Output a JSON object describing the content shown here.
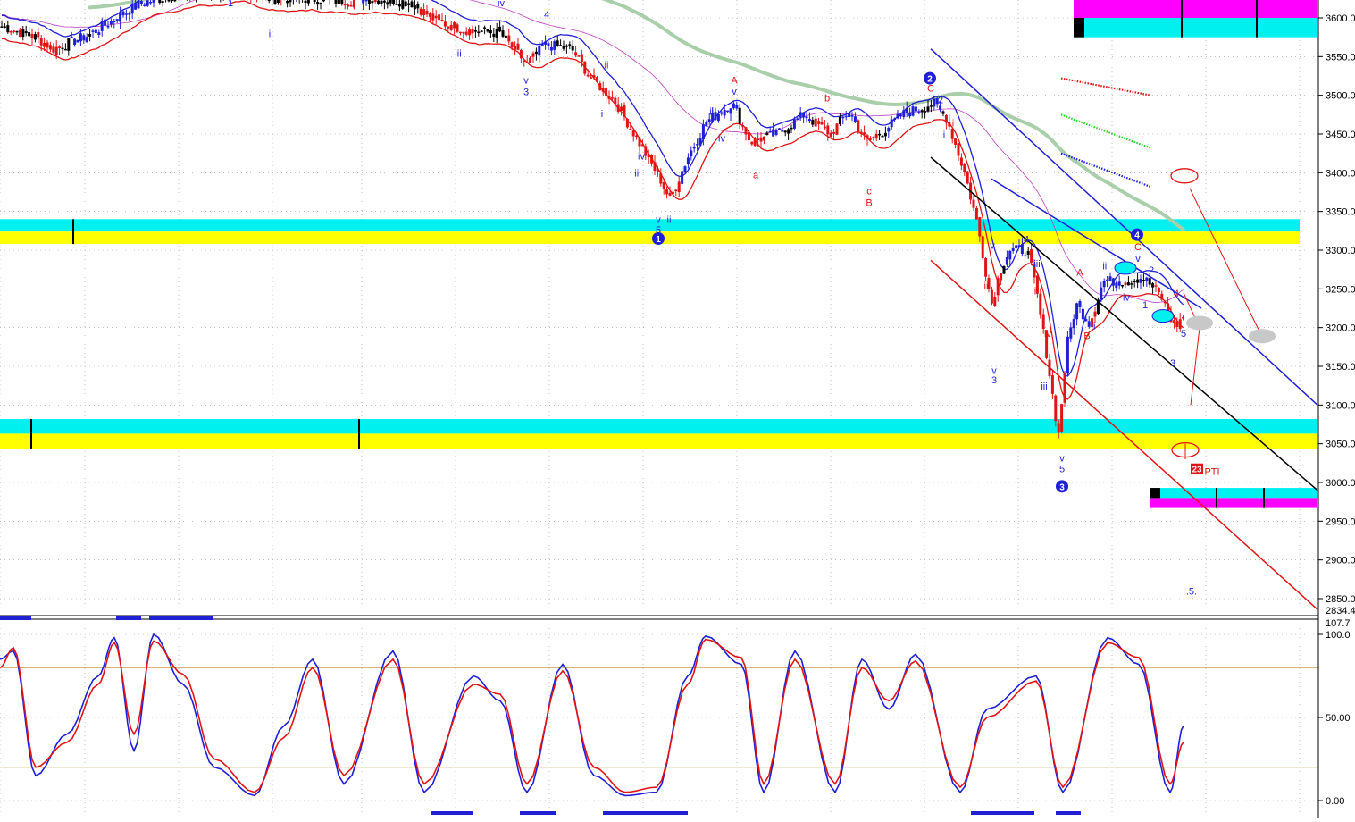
{
  "colors": {
    "background": "#ffffff",
    "grid": "#9a9a9a",
    "bull": "#1f1fd6",
    "bear": "#e01414",
    "neutral": "#000000",
    "cyan": "#00f0f0",
    "yellow": "#ffff00",
    "magenta": "#ff00ff",
    "ma_long": "#a9cfaa",
    "ma_mid": "#c040c0",
    "channel_blue": "#1f1fd6",
    "channel_black": "#000000",
    "channel_red": "#e01414",
    "osc_fast": "#1f1fd6",
    "osc_slow": "#e01414",
    "osc_level": "#c8a050"
  },
  "chart_data": [
    {
      "type": "candlestick",
      "title": "",
      "xlabel": "",
      "ylabel": "",
      "ylim": [
        2834,
        3630
      ],
      "y_ticks": [
        2850,
        2900,
        2950,
        3000,
        3050,
        3100,
        3150,
        3200,
        3250,
        3300,
        3350,
        3400,
        3450,
        3500,
        3550,
        3600
      ],
      "y_tick_labels": [
        "2850.0",
        "2900.0",
        "2950.0",
        "3000.0",
        "3050.0",
        "3100.0",
        "3150.0",
        "3200.0",
        "3250.0",
        "3300.0",
        "3350.0",
        "3400.0",
        "3450.0",
        "3500.0",
        "3550.0",
        "3600.0"
      ],
      "y_min_label": "2834.4",
      "grid": true,
      "price_anchors": [
        [
          0,
          3590
        ],
        [
          40,
          3575
        ],
        [
          60,
          3560
        ],
        [
          100,
          3578
        ],
        [
          130,
          3600
        ],
        [
          160,
          3620
        ],
        [
          200,
          3630
        ],
        [
          260,
          3635
        ],
        [
          300,
          3625
        ],
        [
          340,
          3625
        ],
        [
          380,
          3622
        ],
        [
          420,
          3625
        ],
        [
          460,
          3620
        ],
        [
          490,
          3595
        ],
        [
          520,
          3585
        ],
        [
          560,
          3580
        ],
        [
          590,
          3540
        ],
        [
          610,
          3565
        ],
        [
          640,
          3560
        ],
        [
          660,
          3525
        ],
        [
          690,
          3490
        ],
        [
          720,
          3430
        ],
        [
          740,
          3390
        ],
        [
          750,
          3365
        ],
        [
          770,
          3420
        ],
        [
          790,
          3465
        ],
        [
          820,
          3490
        ],
        [
          840,
          3440
        ],
        [
          870,
          3450
        ],
        [
          900,
          3475
        ],
        [
          930,
          3450
        ],
        [
          950,
          3480
        ],
        [
          970,
          3440
        ],
        [
          990,
          3455
        ],
        [
          1010,
          3475
        ],
        [
          1045,
          3490
        ],
        [
          1060,
          3470
        ],
        [
          1080,
          3400
        ],
        [
          1095,
          3330
        ],
        [
          1110,
          3230
        ],
        [
          1120,
          3275
        ],
        [
          1130,
          3300
        ],
        [
          1150,
          3300
        ],
        [
          1160,
          3250
        ],
        [
          1170,
          3180
        ],
        [
          1185,
          3060
        ],
        [
          1195,
          3180
        ],
        [
          1205,
          3230
        ],
        [
          1220,
          3205
        ],
        [
          1235,
          3260
        ],
        [
          1260,
          3260
        ],
        [
          1280,
          3265
        ],
        [
          1300,
          3240
        ],
        [
          1315,
          3200
        ],
        [
          1325,
          3215
        ]
      ],
      "series": [
        {
          "name": "",
          "kind": "envelope_upper",
          "style": "blue"
        },
        {
          "name": "",
          "kind": "envelope_lower",
          "style": "red"
        },
        {
          "name": "",
          "kind": "moving_average",
          "style": "magenta"
        },
        {
          "name": "",
          "kind": "moving_average",
          "style": "green"
        }
      ],
      "support_resistance_zones": [
        {
          "top": 3340,
          "mid": 3324,
          "bottom": 3308,
          "colors": [
            "cyan",
            "yellow"
          ],
          "from_x": 0,
          "to_x": 1455
        },
        {
          "top": 3082,
          "mid": 3063,
          "bottom": 3043,
          "colors": [
            "cyan",
            "yellow"
          ],
          "from_x": 0,
          "to_x": 1475
        },
        {
          "top": 3626,
          "mid": 3600,
          "bottom": 3575,
          "colors": [
            "magenta",
            "cyan"
          ],
          "from_x": 1202,
          "to_x": 1475
        },
        {
          "top": 2993,
          "mid": 2980,
          "bottom": 2967,
          "colors": [
            "cyan",
            "magenta"
          ],
          "from_x": 1287,
          "to_x": 1475
        }
      ],
      "trend_channel_lines": [
        {
          "color": "blue",
          "from": [
            1042,
            3560
          ],
          "to": [
            1475,
            3100
          ]
        },
        {
          "color": "blue",
          "from": [
            1110,
            3392
          ],
          "to": [
            1345,
            3225
          ]
        },
        {
          "color": "black",
          "from": [
            1042,
            3420
          ],
          "to": [
            1475,
            2990
          ]
        },
        {
          "color": "red",
          "from": [
            1042,
            3287
          ],
          "to": [
            1475,
            2836
          ]
        }
      ],
      "wave_labels": [
        {
          "text": "1",
          "x": 258,
          "price": 3615,
          "color": "blue"
        },
        {
          "text": "i",
          "x": 302,
          "price": 3575,
          "color": "blue"
        },
        {
          "text": "iii",
          "x": 513,
          "price": 3550,
          "color": "blue"
        },
        {
          "text": "iv",
          "x": 561,
          "price": 3615,
          "color": "blue"
        },
        {
          "text": "4",
          "x": 612,
          "price": 3600,
          "color": "blue"
        },
        {
          "text": "v",
          "x": 589,
          "price": 3515,
          "color": "blue"
        },
        {
          "text": "3",
          "x": 589,
          "price": 3500,
          "color": "blue"
        },
        {
          "text": "ii",
          "x": 679,
          "price": 3535,
          "color": "red"
        },
        {
          "text": "i",
          "x": 674,
          "price": 3472,
          "color": "blue"
        },
        {
          "text": "iv",
          "x": 718,
          "price": 3417,
          "color": "blue"
        },
        {
          "text": "iii",
          "x": 714,
          "price": 3395,
          "color": "blue"
        },
        {
          "text": "v",
          "x": 737,
          "price": 3335,
          "color": "blue"
        },
        {
          "text": "5",
          "x": 737,
          "price": 3322,
          "color": "blue"
        },
        {
          "text": "ii",
          "x": 749,
          "price": 3335,
          "color": "blue"
        },
        {
          "text": "A",
          "x": 822,
          "price": 3515,
          "color": "red"
        },
        {
          "text": "v",
          "x": 822,
          "price": 3501,
          "color": "blue"
        },
        {
          "text": "iii",
          "x": 798,
          "price": 3475,
          "color": "blue"
        },
        {
          "text": "iv",
          "x": 808,
          "price": 3440,
          "color": "blue"
        },
        {
          "text": "a",
          "x": 846,
          "price": 3393,
          "color": "red"
        },
        {
          "text": "b",
          "x": 926,
          "price": 3492,
          "color": "red"
        },
        {
          "text": "c",
          "x": 973,
          "price": 3372,
          "color": "red"
        },
        {
          "text": "B",
          "x": 973,
          "price": 3357,
          "color": "red"
        },
        {
          "text": "C",
          "x": 1042,
          "price": 3505,
          "color": "red"
        },
        {
          "text": "2",
          "x": 1053,
          "price": 3490,
          "color": "blue"
        },
        {
          "text": "i",
          "x": 1067,
          "price": 3460,
          "color": "red"
        },
        {
          "text": "i",
          "x": 1057,
          "price": 3445,
          "color": "blue"
        },
        {
          "text": "v",
          "x": 1111,
          "price": 3302,
          "color": "blue"
        },
        {
          "text": "4",
          "x": 1149,
          "price": 3310,
          "color": "blue"
        },
        {
          "text": "ii",
          "x": 1104,
          "price": 3250,
          "color": "red"
        },
        {
          "text": "iii",
          "x": 1161,
          "price": 3278,
          "color": "blue"
        },
        {
          "text": "i",
          "x": 1159,
          "price": 3243,
          "color": "red"
        },
        {
          "text": "v",
          "x": 1113,
          "price": 3140,
          "color": "blue"
        },
        {
          "text": "3",
          "x": 1113,
          "price": 3128,
          "color": "blue"
        },
        {
          "text": "iv",
          "x": 1173,
          "price": 3188,
          "color": "red"
        },
        {
          "text": "iii",
          "x": 1169,
          "price": 3120,
          "color": "blue"
        },
        {
          "text": "v",
          "x": 1189,
          "price": 3027,
          "color": "blue"
        },
        {
          "text": "5",
          "x": 1189,
          "price": 3013,
          "color": "blue"
        },
        {
          "text": "A",
          "x": 1209,
          "price": 3267,
          "color": "red"
        },
        {
          "text": "B",
          "x": 1217,
          "price": 3185,
          "color": "red"
        },
        {
          "text": "ii",
          "x": 1224,
          "price": 3198,
          "color": "blue"
        },
        {
          "text": "iii",
          "x": 1238,
          "price": 3275,
          "color": "blue"
        },
        {
          "text": "iv",
          "x": 1261,
          "price": 3235,
          "color": "blue"
        },
        {
          "text": "C",
          "x": 1274,
          "price": 3300,
          "color": "red"
        },
        {
          "text": "v",
          "x": 1274,
          "price": 3285,
          "color": "blue"
        },
        {
          "text": "2",
          "x": 1289,
          "price": 3270,
          "color": "blue"
        },
        {
          "text": "1",
          "x": 1282,
          "price": 3225,
          "color": "blue"
        },
        {
          "text": "4",
          "x": 1317,
          "price": 3240,
          "color": "red"
        },
        {
          "text": "5",
          "x": 1325,
          "price": 3188,
          "color": "blue"
        },
        {
          "text": "3",
          "x": 1313,
          "price": 3150,
          "color": "blue"
        },
        {
          "text": "PTI",
          "x": 1357,
          "price": 3010,
          "color": "red"
        },
        {
          "text": ".5.",
          "x": 1334,
          "price": 2855,
          "color": "blue"
        }
      ],
      "circled_wave_labels": [
        {
          "text": "1",
          "x": 737,
          "price": 3315
        },
        {
          "text": "2",
          "x": 1041,
          "price": 3522
        },
        {
          "text": "3",
          "x": 1189,
          "price": 2995
        },
        {
          "text": "4",
          "x": 1273,
          "price": 3320
        }
      ],
      "pti_value_badge": {
        "text": "23",
        "x": 1340,
        "price": 3013
      },
      "projection_markers": [
        {
          "shape": "ellipse",
          "style": "red-outline",
          "x": 1326,
          "price": 3396
        },
        {
          "shape": "ellipse",
          "style": "red-outline",
          "x": 1327,
          "price": 3042
        },
        {
          "shape": "ellipse",
          "style": "gray",
          "x": 1413,
          "price": 3189
        },
        {
          "shape": "ellipse",
          "style": "gray",
          "x": 1343,
          "price": 3206
        },
        {
          "shape": "ellipse",
          "style": "cyan",
          "x": 1260,
          "price": 3277
        },
        {
          "shape": "ellipse",
          "style": "cyan",
          "x": 1302,
          "price": 3215
        }
      ]
    },
    {
      "type": "line",
      "title": "",
      "xlabel": "",
      "ylabel": "",
      "ylim": [
        -8,
        107.7
      ],
      "y_ticks": [
        0,
        50,
        100
      ],
      "y_tick_labels": [
        "0.00",
        "50.00",
        "100.0"
      ],
      "y_max_label": "107.7",
      "levels": [
        20,
        80
      ],
      "grid": true,
      "series": [
        {
          "name": "",
          "color": "blue",
          "x": [
            0,
            15,
            40,
            75,
            110,
            128,
            150,
            172,
            205,
            240,
            285,
            318,
            350,
            385,
            440,
            475,
            530,
            560,
            590,
            630,
            665,
            700,
            735,
            770,
            790,
            830,
            855,
            890,
            935,
            965,
            995,
            1025,
            1075,
            1105,
            1160,
            1190,
            1240,
            1275,
            1310,
            1325
          ],
          "values": [
            85,
            90,
            15,
            40,
            75,
            98,
            30,
            100,
            70,
            20,
            3,
            45,
            85,
            10,
            90,
            5,
            75,
            60,
            5,
            82,
            15,
            3,
            5,
            75,
            99,
            82,
            5,
            90,
            5,
            85,
            55,
            88,
            5,
            55,
            75,
            5,
            98,
            82,
            5,
            45
          ]
        },
        {
          "name": "",
          "color": "red",
          "x": [
            0,
            15,
            40,
            75,
            110,
            128,
            150,
            172,
            205,
            240,
            285,
            318,
            350,
            385,
            440,
            475,
            530,
            560,
            590,
            630,
            665,
            700,
            735,
            770,
            790,
            830,
            855,
            890,
            935,
            965,
            995,
            1025,
            1075,
            1105,
            1160,
            1190,
            1240,
            1275,
            1310,
            1325
          ],
          "values": [
            80,
            92,
            20,
            35,
            70,
            95,
            40,
            96,
            76,
            25,
            5,
            38,
            80,
            15,
            85,
            10,
            70,
            64,
            10,
            78,
            20,
            5,
            8,
            70,
            97,
            86,
            10,
            85,
            10,
            80,
            60,
            84,
            8,
            50,
            72,
            8,
            95,
            86,
            10,
            35
          ]
        }
      ]
    }
  ]
}
